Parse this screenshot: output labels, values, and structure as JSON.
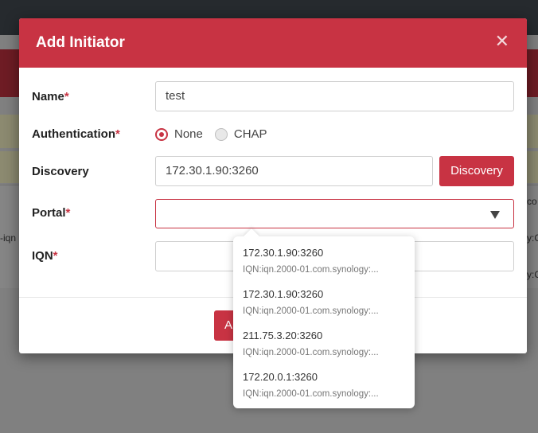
{
  "background": {
    "row_text_left": "-iqn",
    "row_text_right_1": "co",
    "row_text_right_2": "y:C",
    "row_text_right_3": "y:C"
  },
  "modal": {
    "title": "Add Initiator",
    "close_glyph": "✕",
    "fields": {
      "name": {
        "label": "Name",
        "required_mark": "*",
        "value": "test"
      },
      "authentication": {
        "label": "Authentication",
        "required_mark": "*",
        "options": [
          "None",
          "CHAP"
        ],
        "selected": "None"
      },
      "discovery": {
        "label": "Discovery",
        "value": "172.30.1.90:3260",
        "button_label": "Discovery"
      },
      "portal": {
        "label": "Portal",
        "required_mark": "*",
        "value": ""
      },
      "iqn": {
        "label": "IQN",
        "required_mark": "*",
        "value": ""
      }
    },
    "footer_button_partial": "A"
  },
  "portal_dropdown": {
    "items": [
      {
        "portal": "172.30.1.90:3260",
        "iqn": "IQN:iqn.2000-01.com.synology:..."
      },
      {
        "portal": "172.30.1.90:3260",
        "iqn": "IQN:iqn.2000-01.com.synology:..."
      },
      {
        "portal": "211.75.3.20:3260",
        "iqn": "IQN:iqn.2000-01.com.synology:..."
      },
      {
        "portal": "172.20.0.1:3260",
        "iqn": "IQN:iqn.2000-01.com.synology:..."
      }
    ]
  },
  "colors": {
    "accent": "#c83343",
    "overlay": "#808080",
    "topbar": "#262a2e"
  }
}
